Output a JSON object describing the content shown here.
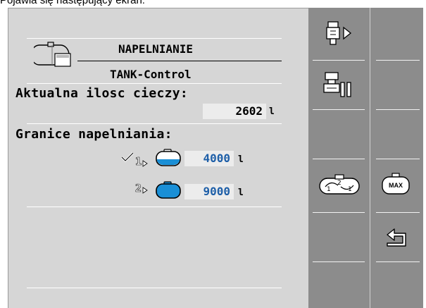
{
  "caption": "Pojawia się następujący ekran:",
  "header": {
    "title": "NAPELNIANIE",
    "subtitle": "TANK-Control"
  },
  "current_volume": {
    "label": "Aktualna ilosc cieczy:",
    "value": "2602",
    "unit": "l"
  },
  "fill_limits": {
    "label": "Granice napelniania:",
    "limit1": {
      "number": "1",
      "value": "4000",
      "unit": "l",
      "selected": true
    },
    "limit2": {
      "number": "2",
      "value": "9000",
      "unit": "l",
      "selected": false
    }
  },
  "softkeys": {
    "max_label": "MAX"
  },
  "colors": {
    "screen_bg": "#d6d6d6",
    "panel_bg": "#8c8c8c",
    "value_blue": "#1e5fa8",
    "tank_blue": "#1a8fd6"
  }
}
